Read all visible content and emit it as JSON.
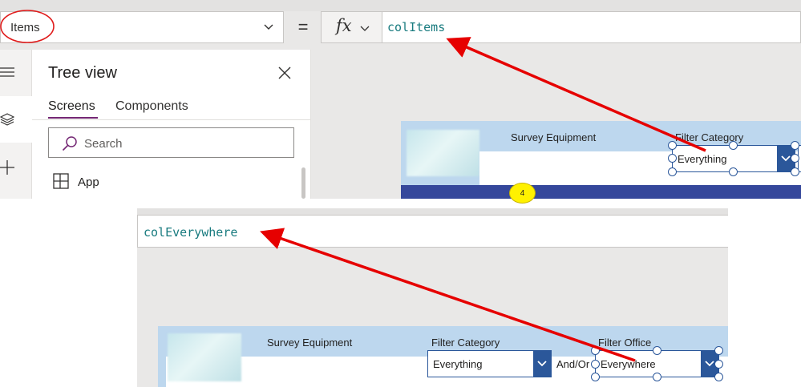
{
  "top_panel": {
    "property_selector": {
      "value": "Items"
    },
    "equals_sign": "=",
    "fx_button": {
      "label": "fx"
    },
    "formula_bar": {
      "value": "colItems"
    },
    "tree_view": {
      "title": "Tree view",
      "tabs": [
        {
          "label": "Screens",
          "selected": true
        },
        {
          "label": "Components",
          "selected": false
        }
      ],
      "search_placeholder": "Search",
      "items": [
        {
          "label": "App",
          "icon": "app-grid-icon"
        }
      ]
    },
    "canvas": {
      "header_title": "Survey Equipment",
      "filter_category_label": "Filter Category",
      "category_dropdown_value": "Everything",
      "badge_count": "4"
    }
  },
  "bottom_panel": {
    "formula_bar": {
      "value": "colEverywhere"
    },
    "canvas": {
      "header_title": "Survey Equipment",
      "filter_category_label": "Filter Category",
      "filter_office_label": "Filter Office",
      "category_dropdown_value": "Everything",
      "andor_label": "And/Or",
      "office_dropdown_value": "Everywhere"
    }
  },
  "annotations": {
    "highlight_color": "#e01b1b",
    "arrow_color": "#e60000"
  },
  "icons": [
    "chevron-down-icon",
    "close-icon",
    "search-icon",
    "hamburger-icon",
    "layers-icon",
    "plus-icon",
    "app-grid-icon"
  ]
}
